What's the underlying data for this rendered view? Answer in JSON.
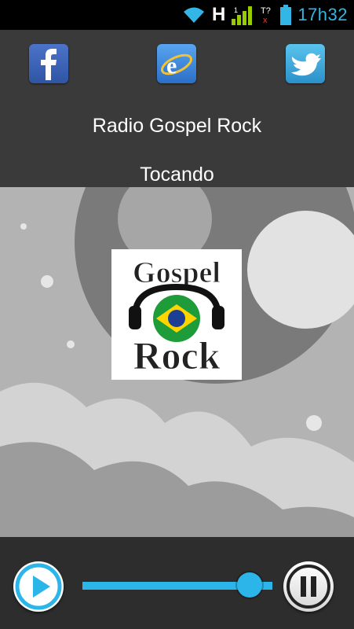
{
  "status_bar": {
    "time": "17h32",
    "network_type": "H",
    "icons": [
      "wifi-icon",
      "signal-icon",
      "sim-missing-icon",
      "battery-icon"
    ]
  },
  "header": {
    "social_icons": [
      "facebook-icon",
      "internet-explorer-icon",
      "twitter-icon"
    ],
    "station_name": "Radio Gospel Rock",
    "status": "Tocando"
  },
  "artwork": {
    "logo_top_text": "Gospel",
    "logo_bottom_text": "Rock"
  },
  "player": {
    "progress": 0.88,
    "accent_color": "#2bb5e8"
  }
}
